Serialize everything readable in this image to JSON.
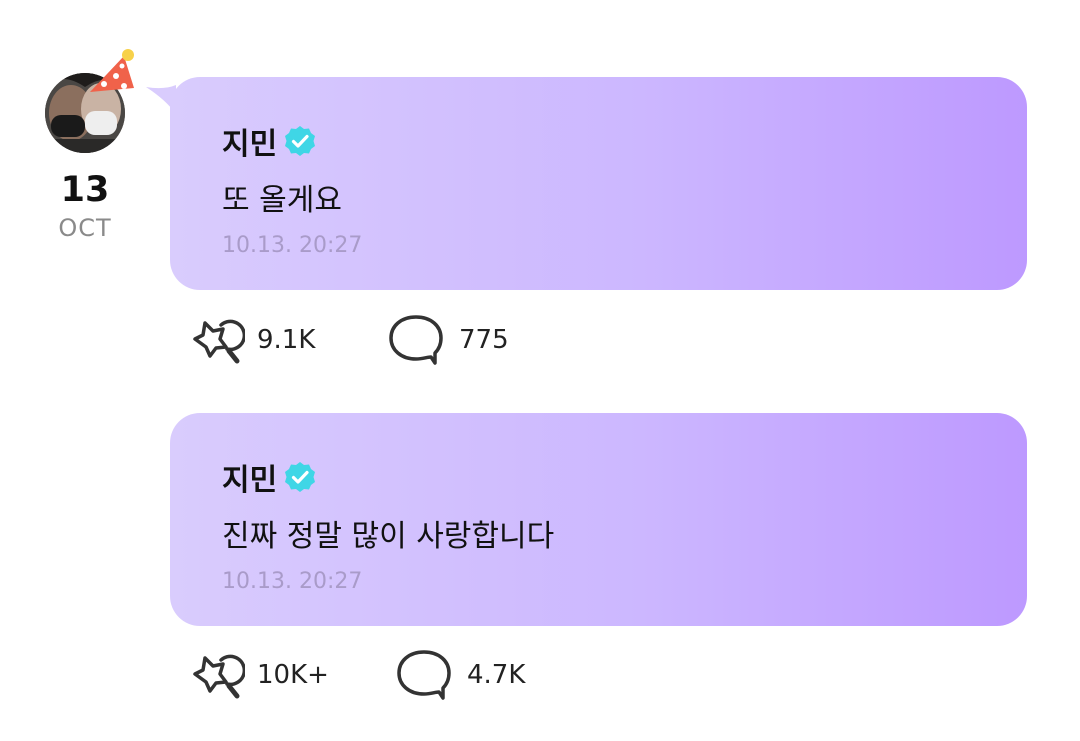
{
  "post_date": {
    "day": "13",
    "month": "OCT"
  },
  "posts": [
    {
      "author": "지민",
      "message": "또 올게요",
      "timestamp": "10.13. 20:27",
      "likes": "9.1K",
      "comments": "775"
    },
    {
      "author": "지민",
      "message": "진짜 정말 많이 사랑합니다",
      "timestamp": "10.13. 20:27",
      "likes": "10K+",
      "comments": "4.7K"
    }
  ],
  "icons": {
    "avatar": "avatar",
    "party_hat": "party-hat-icon",
    "verified": "verified-badge-icon",
    "like": "star-wand-icon",
    "comment": "speech-bubble-icon"
  },
  "colors": {
    "bubble_start": "#d9ccfd",
    "bubble_end": "#bd99ff",
    "verified": "#3fd6e6",
    "timestamp": "#a99bc9",
    "party_hat": "#f0624a"
  }
}
